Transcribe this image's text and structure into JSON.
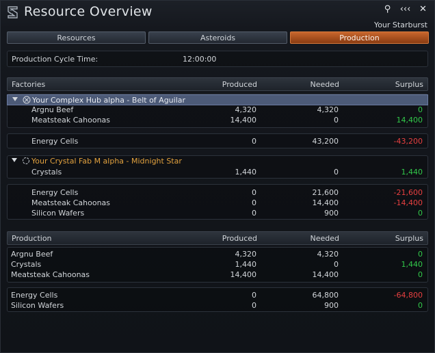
{
  "window": {
    "title": "Resource Overview",
    "subtitle": "Your Starburst",
    "controls": {
      "search": "⚲",
      "collapse": "‹‹‹",
      "close": "✕"
    }
  },
  "tabs": [
    "Resources",
    "Asteroids",
    "Production"
  ],
  "cycle": {
    "label": "Production Cycle Time:",
    "value": "12:00:00"
  },
  "factories": {
    "header": {
      "name": "Factories",
      "produced": "Produced",
      "needed": "Needed",
      "surplus": "Surplus"
    },
    "groups": [
      {
        "name": "Your Complex Hub alpha - Belt of Aguilar",
        "outputs": [
          {
            "name": "Argnu Beef",
            "produced": "4,320",
            "needed": "4,320",
            "surplus": "0"
          },
          {
            "name": "Meatsteak Cahoonas",
            "produced": "14,400",
            "needed": "0",
            "surplus": "14,400"
          }
        ],
        "inputs": [
          {
            "name": "Energy Cells",
            "produced": "0",
            "needed": "43,200",
            "surplus": "-43,200"
          }
        ]
      },
      {
        "name": "Your Crystal Fab M alpha - Midnight Star",
        "outputs": [
          {
            "name": "Crystals",
            "produced": "1,440",
            "needed": "0",
            "surplus": "1,440"
          }
        ],
        "inputs": [
          {
            "name": "Energy Cells",
            "produced": "0",
            "needed": "21,600",
            "surplus": "-21,600"
          },
          {
            "name": "Meatsteak Cahoonas",
            "produced": "0",
            "needed": "14,400",
            "surplus": "-14,400"
          },
          {
            "name": "Silicon Wafers",
            "produced": "0",
            "needed": "900",
            "surplus": "0"
          }
        ]
      }
    ]
  },
  "production": {
    "header": {
      "name": "Production",
      "produced": "Produced",
      "needed": "Needed",
      "surplus": "Surplus"
    },
    "outputs": [
      {
        "name": "Argnu Beef",
        "produced": "4,320",
        "needed": "4,320",
        "surplus": "0"
      },
      {
        "name": "Crystals",
        "produced": "1,440",
        "needed": "0",
        "surplus": "1,440"
      },
      {
        "name": "Meatsteak Cahoonas",
        "produced": "14,400",
        "needed": "14,400",
        "surplus": "0"
      }
    ],
    "inputs": [
      {
        "name": "Energy Cells",
        "produced": "0",
        "needed": "64,800",
        "surplus": "-64,800"
      },
      {
        "name": "Silicon Wafers",
        "produced": "0",
        "needed": "900",
        "surplus": "0"
      }
    ]
  }
}
